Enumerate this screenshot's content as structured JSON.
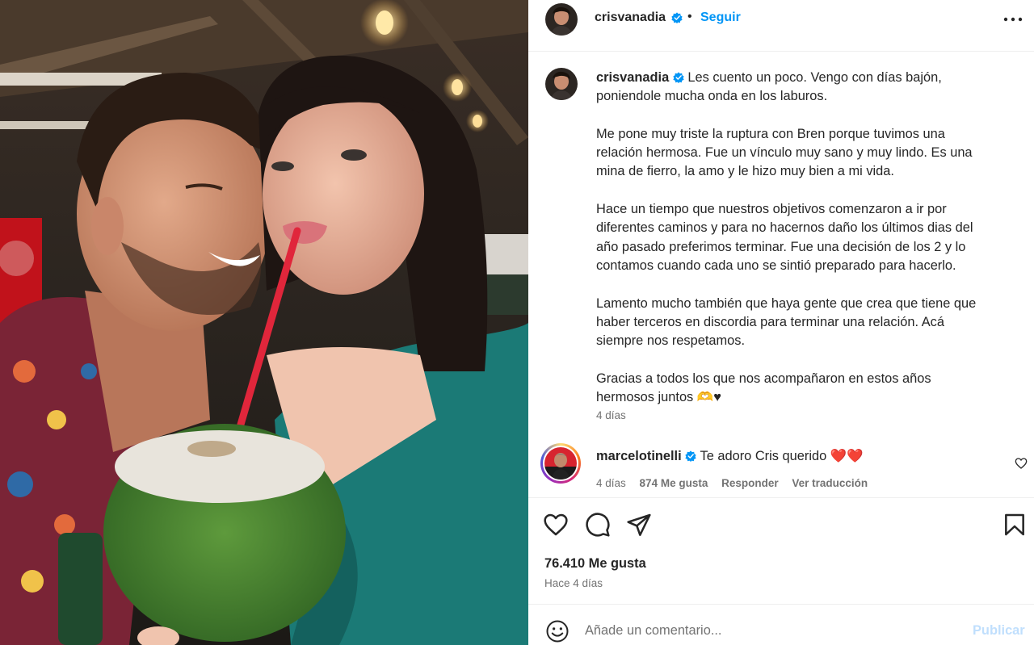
{
  "post": {
    "username": "crisvanadia",
    "follow_label": "Seguir",
    "dot": "•",
    "caption": {
      "username": "crisvanadia",
      "lines": [
        "Les cuento un poco. Vengo con días bajón,",
        "poniendole mucha onda en los laburos.",
        "",
        "Me pone muy triste la ruptura con Bren porque tuvimos una",
        "relación hermosa. Fue un vínculo muy sano y muy lindo. Es una",
        "mina de fierro, la amo y le hizo muy bien a mi vida.",
        "",
        "Hace un tiempo que nuestros objetivos comenzaron a ir por",
        "diferentes caminos y para no hacernos daño los últimos dias del",
        "año pasado preferimos terminar. Fue una decisión de los 2 y lo",
        "contamos cuando cada uno se sintió preparado para hacerlo.",
        "",
        "Lamento mucho también que haya gente que crea que tiene que",
        "haber terceros en discordia para terminar una relación. Acá",
        "siempre nos respetamos.",
        "",
        "Gracias a todos los que nos acompañaron en estos años",
        "hermosos juntos 🫶♥"
      ],
      "time": "4 días"
    },
    "comment": {
      "username": "marcelotinelli",
      "text": "Te adoro Cris querido",
      "emoji": "❤️❤️",
      "time": "4 días",
      "likes": "874 Me gusta",
      "reply_label": "Responder",
      "translate_label": "Ver traducción"
    },
    "likes_count": "76.410 Me gusta",
    "posted": "Hace 4 días",
    "add_comment": {
      "placeholder": "Añade un comentario...",
      "publish_label": "Publicar"
    }
  },
  "icons": {
    "verified": "verified-badge-icon",
    "more": "more-options-icon",
    "like": "heart-icon",
    "comment": "comment-bubble-icon",
    "share": "paper-plane-icon",
    "save": "bookmark-icon",
    "emoji": "emoji-smile-icon"
  },
  "colors": {
    "accent": "#0095f6",
    "verified": "#0095f6",
    "text": "#262626",
    "secondary": "#737373",
    "divider": "#efefef",
    "publish_disabled": "#c0dffd"
  }
}
